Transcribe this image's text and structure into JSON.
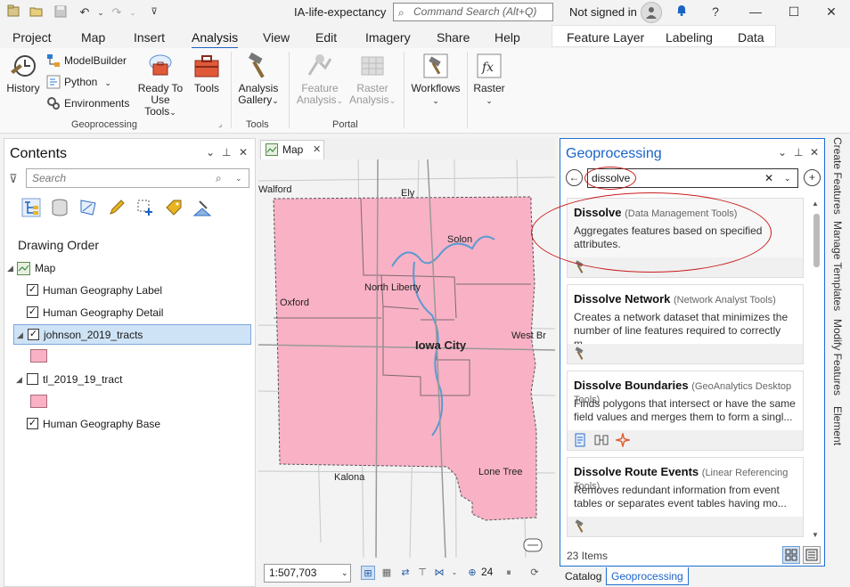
{
  "title_bar": {
    "title": "IA-life-expectancy",
    "command_search_placeholder": "Command Search (Alt+Q)",
    "sign_in": "Not signed in",
    "help": "?"
  },
  "ribbon_tabs": [
    "Project",
    "Map",
    "Insert",
    "Analysis",
    "View",
    "Edit",
    "Imagery",
    "Share",
    "Help"
  ],
  "active_tab": "Analysis",
  "contextual_tabs": [
    "Feature Layer",
    "Labeling",
    "Data"
  ],
  "ribbon": {
    "history": "History",
    "modelbuilder": "ModelBuilder",
    "python": "Python",
    "environments": "Environments",
    "ready_to_use_1": "Ready To",
    "ready_to_use_2": "Use Tools",
    "tools": "Tools",
    "geoprocessing_group": "Geoprocessing",
    "analysis_gallery_1": "Analysis",
    "analysis_gallery_2": "Gallery",
    "tools_group": "Tools",
    "feature_analysis_1": "Feature",
    "feature_analysis_2": "Analysis",
    "raster_analysis_1": "Raster",
    "raster_analysis_2": "Analysis",
    "portal_group": "Portal",
    "workflows": "Workflows",
    "raster": "Raster"
  },
  "contents": {
    "title": "Contents",
    "search_placeholder": "Search",
    "drawing_order": "Drawing Order",
    "map": "Map",
    "layers": [
      {
        "name": "Human Geography Label",
        "checked": true
      },
      {
        "name": "Human Geography Detail",
        "checked": true
      },
      {
        "name": "johnson_2019_tracts",
        "checked": true
      },
      {
        "name": "tl_2019_19_tract",
        "checked": false
      },
      {
        "name": "Human Geography Base",
        "checked": true
      }
    ],
    "swatch_color": "#f9b1c6"
  },
  "map": {
    "tab_label": "Map",
    "scale": "1:507,703",
    "selected_count": "24",
    "places": [
      "Walford",
      "Ely",
      "Solon",
      "North Liberty",
      "Oxford",
      "Iowa City",
      "West Br",
      "Kalona",
      "Lone Tree"
    ],
    "fill_color": "#f9b1c6"
  },
  "geoprocessing": {
    "title": "Geoprocessing",
    "search_value": "dissolve",
    "results": [
      {
        "name": "Dissolve",
        "toolbox": "(Data Management Tools)",
        "desc_1": "Aggregates features based on specified",
        "desc_2": "attributes."
      },
      {
        "name": "Dissolve Network",
        "toolbox": "(Network Analyst Tools)",
        "desc_1": "Creates a network dataset that minimizes the",
        "desc_2": "number of line features required to correctly m..."
      },
      {
        "name": "Dissolve Boundaries",
        "toolbox": "(GeoAnalytics Desktop Tools)",
        "desc_1": "Finds polygons that intersect or have the same",
        "desc_2": "field values and merges them to form a singl..."
      },
      {
        "name": "Dissolve Route Events",
        "toolbox": "(Linear Referencing Tools)",
        "desc_1": "Removes redundant information from event",
        "desc_2": "tables or separates event tables having mo..."
      }
    ],
    "item_count": "23 Items"
  },
  "bottom_tabs": [
    "Catalog",
    "Geoprocessing"
  ],
  "side_rail": [
    "Create Features",
    "Manage Templates",
    "Modify Features",
    "Element"
  ],
  "colors": {
    "accent": "#1f6fd1",
    "annotation": "#c81b1b"
  }
}
